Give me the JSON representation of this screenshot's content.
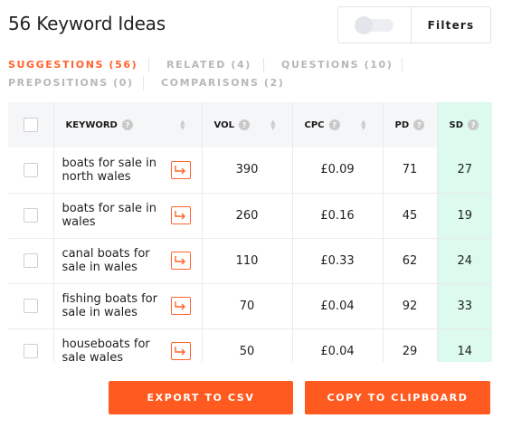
{
  "header": {
    "title": "56 Keyword Ideas",
    "filters_label": "Filters",
    "toggle_on": false
  },
  "tabs": [
    {
      "label": "SUGGESTIONS (56)",
      "active": true
    },
    {
      "label": "RELATED (4)",
      "active": false
    },
    {
      "label": "QUESTIONS (10)",
      "active": false
    },
    {
      "label": "PREPOSITIONS (0)",
      "active": false
    },
    {
      "label": "COMPARISONS (2)",
      "active": false
    }
  ],
  "table": {
    "columns": {
      "keyword": "KEYWORD",
      "vol": "VOL",
      "cpc": "CPC",
      "pd": "PD",
      "sd": "SD"
    },
    "rows": [
      {
        "keyword": "boats for sale in north wales",
        "vol": "390",
        "cpc": "£0.09",
        "pd": "71",
        "sd": "27"
      },
      {
        "keyword": "boats for sale in wales",
        "vol": "260",
        "cpc": "£0.16",
        "pd": "45",
        "sd": "19"
      },
      {
        "keyword": "canal boats for sale in wales",
        "vol": "110",
        "cpc": "£0.33",
        "pd": "62",
        "sd": "24"
      },
      {
        "keyword": "fishing boats for sale in wales",
        "vol": "70",
        "cpc": "£0.04",
        "pd": "92",
        "sd": "33"
      },
      {
        "keyword": "houseboats for sale wales",
        "vol": "50",
        "cpc": "£0.04",
        "pd": "29",
        "sd": "14"
      }
    ]
  },
  "actions": {
    "export_label": "EXPORT TO CSV",
    "copy_label": "COPY TO CLIPBOARD"
  },
  "colors": {
    "accent": "#ff5a1f",
    "sd_highlight": "#ddfaee"
  }
}
